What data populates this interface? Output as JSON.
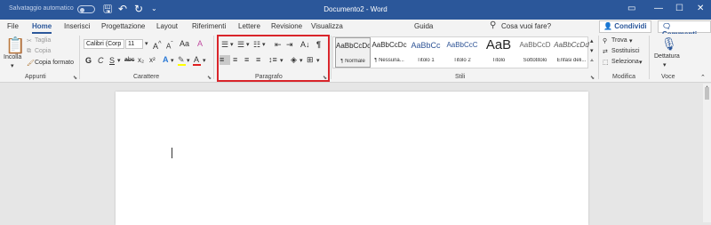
{
  "titlebar": {
    "autosave_label": "Salvataggio automatico",
    "doc_title": "Documento2 - Word"
  },
  "tabs": [
    "File",
    "Home",
    "Inserisci",
    "Progettazione",
    "Layout",
    "Riferimenti",
    "Lettere",
    "Revisione",
    "Visualizza",
    "Guida"
  ],
  "active_tab": "Home",
  "tell_me": "Cosa vuoi fare?",
  "share_label": "Condividi",
  "comments_label": "Commenti",
  "clipboard": {
    "paste": "Incolla",
    "cut": "Taglia",
    "copy": "Copia",
    "format_painter": "Copia formato",
    "group": "Appunti"
  },
  "font": {
    "family": "Calibri (Corp",
    "size": "11",
    "group": "Carattere",
    "bold": "G",
    "italic": "C",
    "underline": "S",
    "strike": "abc",
    "subscript": "x₂",
    "superscript": "x²",
    "clear": "A"
  },
  "paragraph": {
    "group": "Paragrafo"
  },
  "styles": {
    "group": "Stili",
    "items": [
      {
        "sample": "AaBbCcDc",
        "name": "¶ Normale"
      },
      {
        "sample": "AaBbCcDc",
        "name": "¶ Nessuna..."
      },
      {
        "sample": "AaBbCc",
        "name": "Titolo 1"
      },
      {
        "sample": "AaBbCcC",
        "name": "Titolo 2"
      },
      {
        "sample": "AaB",
        "name": "Titolo"
      },
      {
        "sample": "AaBbCcD",
        "name": "Sottotitolo"
      },
      {
        "sample": "AaBbCcDd",
        "name": "Enfasi deli..."
      }
    ]
  },
  "editing": {
    "find": "Trova",
    "replace": "Sostituisci",
    "select": "Seleziona",
    "group": "Modifica"
  },
  "voice": {
    "dictate": "Dettatura",
    "group": "Voce"
  },
  "colors": {
    "accent": "#2b579a",
    "highlight_box": "#d9252b"
  }
}
